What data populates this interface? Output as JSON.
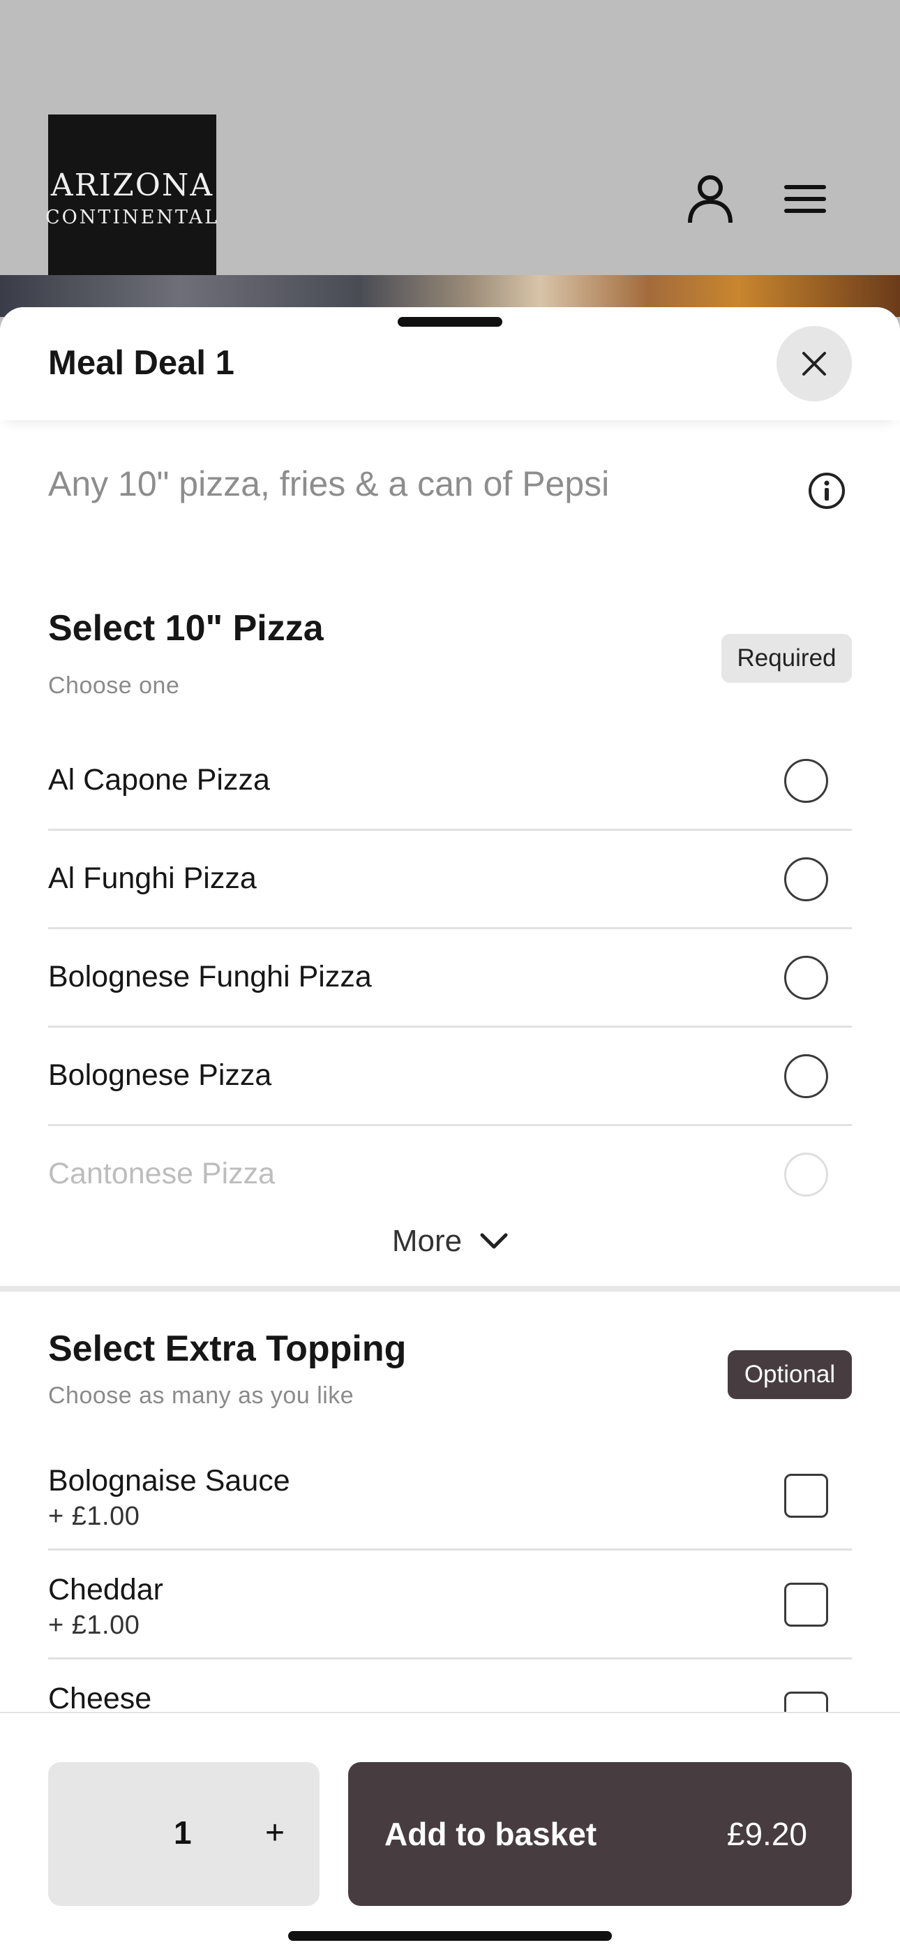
{
  "header": {
    "logo_line1": "ARIZONA",
    "logo_line2": "CONTINENTAL"
  },
  "sheet": {
    "title": "Meal Deal 1",
    "description": "Any 10\" pizza, fries & a can of Pepsi"
  },
  "pizza_section": {
    "title": "Select 10\" Pizza",
    "subtitle": "Choose one",
    "badge": "Required",
    "options": [
      {
        "label": "Al Capone Pizza"
      },
      {
        "label": "Al Funghi Pizza"
      },
      {
        "label": "Bolognese Funghi Pizza"
      },
      {
        "label": "Bolognese Pizza"
      },
      {
        "label": "Cantonese Pizza"
      }
    ],
    "more_label": "More"
  },
  "topping_section": {
    "title": "Select Extra Topping",
    "subtitle": "Choose as many as you like",
    "badge": "Optional",
    "options": [
      {
        "label": "Bolognaise Sauce",
        "price": "+ £1.00"
      },
      {
        "label": "Cheddar",
        "price": "+ £1.00"
      },
      {
        "label": "Cheese"
      }
    ]
  },
  "footer": {
    "quantity": "1",
    "plus_label": "+",
    "add_label": "Add to basket",
    "total": "£9.20"
  },
  "colors": {
    "accent": "#473d40",
    "header_bg": "#bdbdbd"
  }
}
